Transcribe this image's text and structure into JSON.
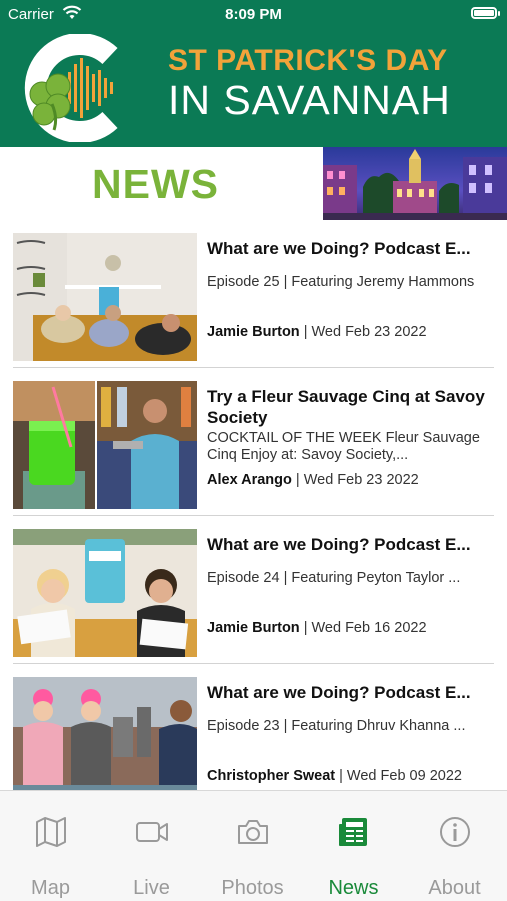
{
  "status_bar": {
    "carrier": "Carrier",
    "time": "8:09 PM"
  },
  "banner": {
    "line1": "ST PATRICK'S DAY",
    "line2": "IN SAVANNAH"
  },
  "section_title": "NEWS",
  "articles": [
    {
      "title": "What are we Doing? Podcast E...",
      "excerpt": "Episode 25 | Featuring Jeremy Hammons",
      "author": "Jamie Burton",
      "date": "| Wed Feb 23 2022"
    },
    {
      "title": "Try a Fleur Sauvage Cinq at Savoy Society",
      "excerpt": "COCKTAIL OF THE WEEK  Fleur Sauvage Cinq  Enjoy at: Savoy Society,...",
      "author": "Alex Arango",
      "date": "| Wed Feb 23 2022"
    },
    {
      "title": "What are we Doing? Podcast E...",
      "excerpt": "Episode 24 | Featuring Peyton Taylor  ...",
      "author": "Jamie Burton",
      "date": "| Wed Feb 16 2022"
    },
    {
      "title": "What are we Doing? Podcast E...",
      "excerpt": "Episode 23 | Featuring Dhruv Khanna  ...",
      "author": "Christopher Sweat",
      "date": "| Wed Feb 09 2022"
    }
  ],
  "tabs": [
    {
      "label": "Map",
      "icon": "map-icon"
    },
    {
      "label": "Live",
      "icon": "video-icon"
    },
    {
      "label": "Photos",
      "icon": "camera-icon"
    },
    {
      "label": "News",
      "icon": "newspaper-icon",
      "active": true
    },
    {
      "label": "About",
      "icon": "info-icon"
    }
  ],
  "colors": {
    "brand_green": "#0b7a55",
    "news_green": "#7ab33a",
    "accent_orange": "#f2a33a",
    "active_tab": "#1a8a3a"
  }
}
